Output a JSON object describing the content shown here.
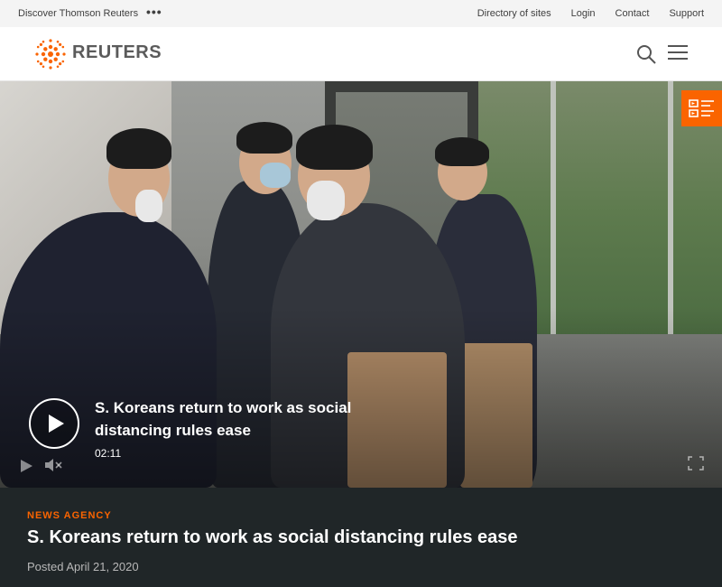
{
  "topbar": {
    "discover": "Discover Thomson Reuters",
    "more": "•••",
    "links": [
      "Directory of sites",
      "Login",
      "Contact",
      "Support"
    ]
  },
  "header": {
    "brand": "REUTERS",
    "icons": {
      "search": "search-icon",
      "menu": "hamburger-menu-icon",
      "logo": "reuters-dot-logo"
    }
  },
  "video": {
    "title": "S. Koreans return to work as social distancing rules ease",
    "duration": "02:11",
    "icons": {
      "playlist": "playlist-icon",
      "play": "play-icon",
      "volume": "mute-icon",
      "fullscreen": "fullscreen-icon"
    }
  },
  "article": {
    "kicker": "NEWS AGENCY",
    "headline": "S. Koreans return to work as social distancing rules ease",
    "posted": "Posted April 21, 2020"
  },
  "colors": {
    "accent": "#fa6400",
    "panel": "#202628",
    "topbar": "#f4f4f4"
  }
}
